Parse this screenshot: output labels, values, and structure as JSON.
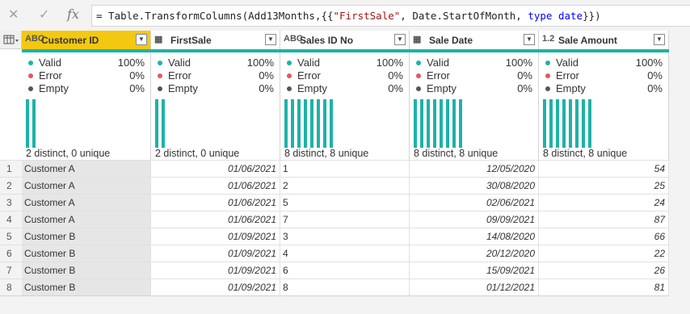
{
  "formula_bar": {
    "cancel_icon": "close-icon",
    "confirm_icon": "checkmark-icon",
    "fx_label": "fx",
    "formula_prefix": "= Table.TransformColumns(Add13Months,{{",
    "formula_str1": "\"FirstSale\"",
    "formula_mid": ", Date.StartOfMonth, ",
    "formula_kw": "type",
    "formula_mid2": " date",
    "formula_suffix": "}})"
  },
  "columns": [
    {
      "type_icon": "ABC",
      "name": "Customer ID",
      "valid_label": "Valid",
      "valid": "100%",
      "error_label": "Error",
      "error": "0%",
      "empty_label": "Empty",
      "empty": "0%",
      "distinct": "2 distinct, 0 unique",
      "bars": 2
    },
    {
      "type_icon": "▦",
      "name": "FirstSale",
      "valid_label": "Valid",
      "valid": "100%",
      "error_label": "Error",
      "error": "0%",
      "empty_label": "Empty",
      "empty": "0%",
      "distinct": "2 distinct, 0 unique",
      "bars": 2
    },
    {
      "type_icon": "ABC",
      "name": "Sales ID No",
      "valid_label": "Valid",
      "valid": "100%",
      "error_label": "Error",
      "error": "0%",
      "empty_label": "Empty",
      "empty": "0%",
      "distinct": "8 distinct, 8 unique",
      "bars": 8
    },
    {
      "type_icon": "▦",
      "name": "Sale Date",
      "valid_label": "Valid",
      "valid": "100%",
      "error_label": "Error",
      "error": "0%",
      "empty_label": "Empty",
      "empty": "0%",
      "distinct": "8 distinct, 8 unique",
      "bars": 8
    },
    {
      "type_icon": "1.2",
      "name": "Sale Amount",
      "valid_label": "Valid",
      "valid": "100%",
      "error_label": "Error",
      "error": "0%",
      "empty_label": "Empty",
      "empty": "0%",
      "distinct": "8 distinct, 8 unique",
      "bars": 8
    }
  ],
  "colors": {
    "valid": "#1eb2a6",
    "error": "#e8555f",
    "empty": "#555555",
    "selected_header": "#f2c811"
  },
  "rows": [
    {
      "n": "1",
      "customer": "Customer A",
      "first_sale": "01/06/2021",
      "sales_id": "1",
      "sale_date": "12/05/2020",
      "amount": "54"
    },
    {
      "n": "2",
      "customer": "Customer A",
      "first_sale": "01/06/2021",
      "sales_id": "2",
      "sale_date": "30/08/2020",
      "amount": "25"
    },
    {
      "n": "3",
      "customer": "Customer A",
      "first_sale": "01/06/2021",
      "sales_id": "5",
      "sale_date": "02/06/2021",
      "amount": "24"
    },
    {
      "n": "4",
      "customer": "Customer A",
      "first_sale": "01/06/2021",
      "sales_id": "7",
      "sale_date": "09/09/2021",
      "amount": "87"
    },
    {
      "n": "5",
      "customer": "Customer B",
      "first_sale": "01/09/2021",
      "sales_id": "3",
      "sale_date": "14/08/2020",
      "amount": "66"
    },
    {
      "n": "6",
      "customer": "Customer B",
      "first_sale": "01/09/2021",
      "sales_id": "4",
      "sale_date": "20/12/2020",
      "amount": "22"
    },
    {
      "n": "7",
      "customer": "Customer B",
      "first_sale": "01/09/2021",
      "sales_id": "6",
      "sale_date": "15/09/2021",
      "amount": "26"
    },
    {
      "n": "8",
      "customer": "Customer B",
      "first_sale": "01/09/2021",
      "sales_id": "8",
      "sale_date": "01/12/2021",
      "amount": "81"
    }
  ]
}
